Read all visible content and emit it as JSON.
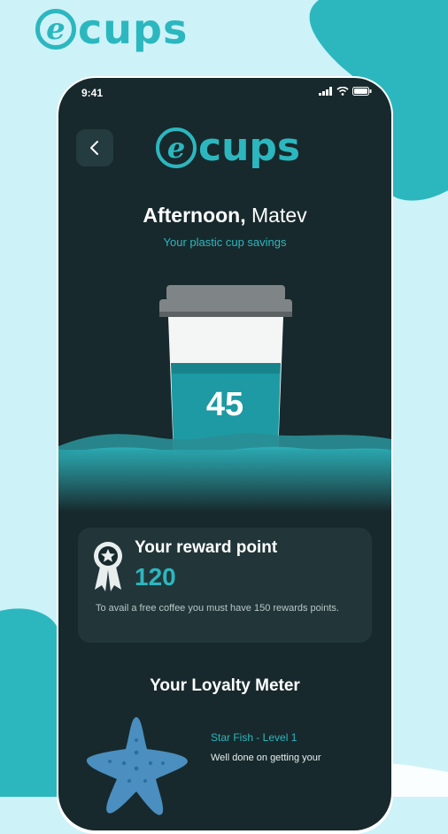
{
  "brand": {
    "mark": "e",
    "word": "cups"
  },
  "status_bar": {
    "time": "9:41"
  },
  "header": {
    "back_icon": "chevron-left-icon"
  },
  "greeting": {
    "time_of_day": "Afternoon,",
    "name": " Matev"
  },
  "subtitle": "Your plastic cup savings",
  "cup": {
    "count": "45"
  },
  "reward": {
    "title": "Your reward point",
    "points": "120",
    "note": "To avail a free coffee you must have 150 rewards points.",
    "icon": "award-ribbon-icon"
  },
  "loyalty": {
    "title": "Your Loyalty Meter",
    "level_label": "Star Fish - Level 1",
    "level_note": "Well done on getting your",
    "icon": "starfish-icon"
  },
  "colors": {
    "accent": "#2cb7bf",
    "background": "#cdf2f8",
    "screen": "#17292c",
    "card": "#223639"
  }
}
